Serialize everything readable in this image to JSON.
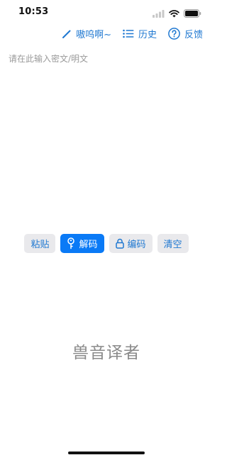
{
  "status_bar": {
    "time": "10:53",
    "icons": [
      "signal-icon",
      "wifi-icon",
      "battery-icon"
    ]
  },
  "toolbar": {
    "nickname_label": "嗷呜啊~",
    "history_label": "历史",
    "feedback_label": "反馈",
    "accent_color": "#1f78d1"
  },
  "editor": {
    "value": "",
    "placeholder": "请在此输入密文/明文"
  },
  "actions": {
    "paste_label": "粘贴",
    "decode_label": "解码",
    "encode_label": "编码",
    "clear_label": "清空",
    "primary_color": "#0a7af6",
    "secondary_bg": "#e9e9ec"
  },
  "brand": {
    "title": "兽音译者"
  }
}
